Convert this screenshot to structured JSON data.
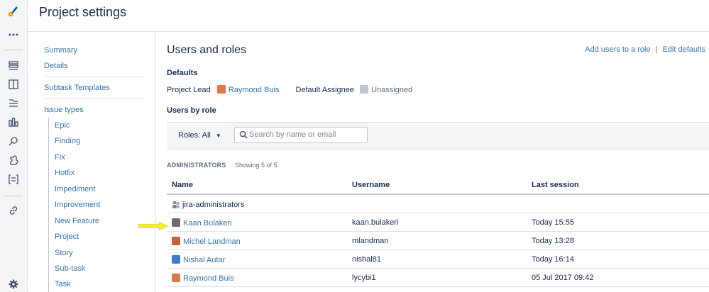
{
  "page": {
    "title": "Project settings"
  },
  "sidenav": {
    "items": [
      {
        "label": "Summary"
      },
      {
        "label": "Details"
      },
      {
        "label": "Subtask Templates"
      },
      {
        "label": "Issue types"
      }
    ],
    "issue_types": [
      {
        "label": "Epic"
      },
      {
        "label": "Finding"
      },
      {
        "label": "Fix"
      },
      {
        "label": "Hotfix"
      },
      {
        "label": "Impediment"
      },
      {
        "label": "Improvement"
      },
      {
        "label": "New Feature"
      },
      {
        "label": "Project"
      },
      {
        "label": "Story"
      },
      {
        "label": "Sub-task"
      },
      {
        "label": "Task"
      }
    ]
  },
  "main": {
    "heading": "Users and roles",
    "links": {
      "add_users": "Add users to a role",
      "separator": "|",
      "edit_defaults": "Edit defaults"
    },
    "defaults": {
      "heading": "Defaults",
      "project_lead_label": "Project Lead",
      "project_lead_value": "Raymond Buis",
      "default_assignee_label": "Default Assignee",
      "default_assignee_value": "Unassigned"
    },
    "users_by_role": {
      "heading": "Users by role",
      "roles_button": "Roles: All",
      "search_placeholder": "Search by name or email"
    },
    "group": {
      "label": "ADMINISTRATORS",
      "showing": "Showing 5 of 5"
    },
    "table": {
      "columns": [
        "Name",
        "Username",
        "Last session"
      ],
      "rows": [
        {
          "name": "jira-administrators",
          "username": "",
          "last_session": "",
          "type": "group"
        },
        {
          "name": "Kaan Bulakeri",
          "username": "kaan.bulakeri",
          "last_session": "Today 15:55",
          "type": "user"
        },
        {
          "name": "Michel Landman",
          "username": "mlandman",
          "last_session": "Today 13:28",
          "type": "user"
        },
        {
          "name": "Nishal Autar",
          "username": "nishal81",
          "last_session": "Today 16:14",
          "type": "user"
        },
        {
          "name": "Raymond Buis",
          "username": "lycybi1",
          "last_session": "05 Jul 2017 09:42",
          "type": "user"
        }
      ]
    }
  },
  "colors": {
    "link": "#3572b0",
    "annotation_arrow": "#f2ee2a",
    "rail_bg": "#f4f5f7"
  },
  "icons": {
    "rail": [
      "rocket-logo-icon",
      "more-icon",
      "backlog-icon",
      "board-icon",
      "releases-icon",
      "reports-icon",
      "issues-search-icon",
      "components-icon",
      "add-item-icon",
      "link-icon",
      "settings-icon"
    ]
  }
}
